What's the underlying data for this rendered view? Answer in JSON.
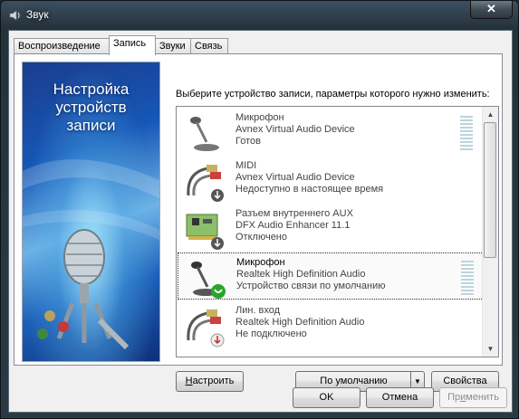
{
  "window": {
    "title": "Звук"
  },
  "tabs": [
    {
      "label": "Воспроизведение"
    },
    {
      "label": "Запись"
    },
    {
      "label": "Звуки"
    },
    {
      "label": "Связь"
    }
  ],
  "banner": {
    "line1": "Настройка",
    "line2": "устройств",
    "line3": "записи"
  },
  "instruction": "Выберите устройство записи, параметры которого нужно изменить:",
  "devices": [
    {
      "name": "Микрофон",
      "driver": "Avnex Virtual Audio Device",
      "status": "Готов",
      "icon": "microphone-icon"
    },
    {
      "name": "MIDI",
      "driver": "Avnex Virtual Audio Device",
      "status": "Недоступно в настоящее время",
      "icon": "rca-cable-icon"
    },
    {
      "name": "Разъем внутреннего  AUX",
      "driver": "DFX Audio Enhancer 11.1",
      "status": "Отключено",
      "icon": "sound-card-icon"
    },
    {
      "name": "Микрофон",
      "driver": "Realtek High Definition Audio",
      "status": "Устройство связи по умолчанию",
      "icon": "microphone-icon",
      "selected": true
    },
    {
      "name": "Лин. вход",
      "driver": "Realtek High Definition Audio",
      "status": "Не подключено",
      "icon": "rca-cable-icon"
    }
  ],
  "buttons": {
    "configure_prefix": "Н",
    "configure_rest": "астроить",
    "default": "По умолчанию",
    "properties": "Свойства",
    "ok": "OK",
    "cancel": "Отмена",
    "apply_prefix": "Пр",
    "apply_u": "и",
    "apply_rest": "менить"
  },
  "colors": {
    "badge_green": "#2aa52a",
    "badge_red": "#cc2a2a",
    "badge_gray": "#555555"
  }
}
